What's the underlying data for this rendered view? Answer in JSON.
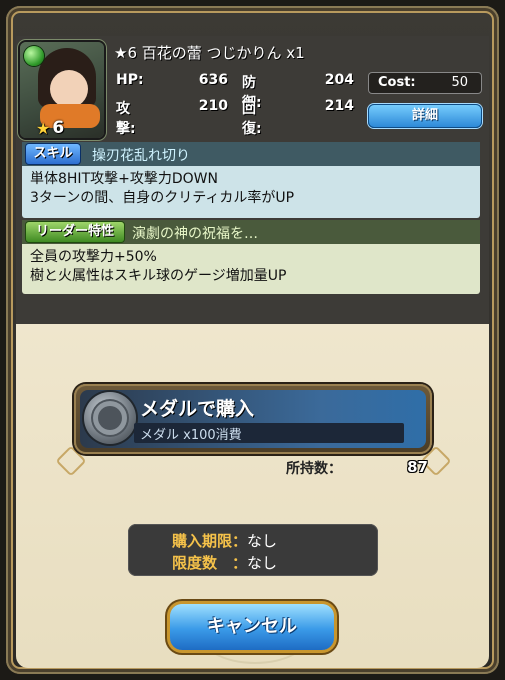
{
  "card": {
    "title": "★6 百花の蕾 つじかりん x1",
    "rarity": "6",
    "attribute_color": "#2f9a2a"
  },
  "stats": {
    "hp_label": "HP:",
    "hp_value": "636",
    "def_label": "防御:",
    "def_value": "204",
    "atk_label": "攻撃:",
    "atk_value": "210",
    "rec_label": "回復:",
    "rec_value": "214"
  },
  "cost": {
    "label": "Cost:",
    "value": "50"
  },
  "detail_button": "詳細",
  "skill": {
    "tag": "スキル",
    "name": "操刃花乱れ切り",
    "line1": "単体8HIT攻撃+攻撃力DOWN",
    "line2": "3ターンの間、自身のクリティカル率がUP"
  },
  "leader": {
    "tag": "リーダー特性",
    "name": "演劇の神の祝福を…",
    "line1": "全員の攻撃力+50%",
    "line2": "樹と火属性はスキル球のゲージ増加量UP"
  },
  "purchase": {
    "title": "メダルで購入",
    "subtitle": "メダル x100消費",
    "owned_label": "所持数：",
    "owned_value": "87"
  },
  "limits": {
    "period_label": "購入期限：",
    "period_value": "なし",
    "count_label": "限度数　：",
    "count_value": "なし"
  },
  "cancel_button": "キャンセル"
}
